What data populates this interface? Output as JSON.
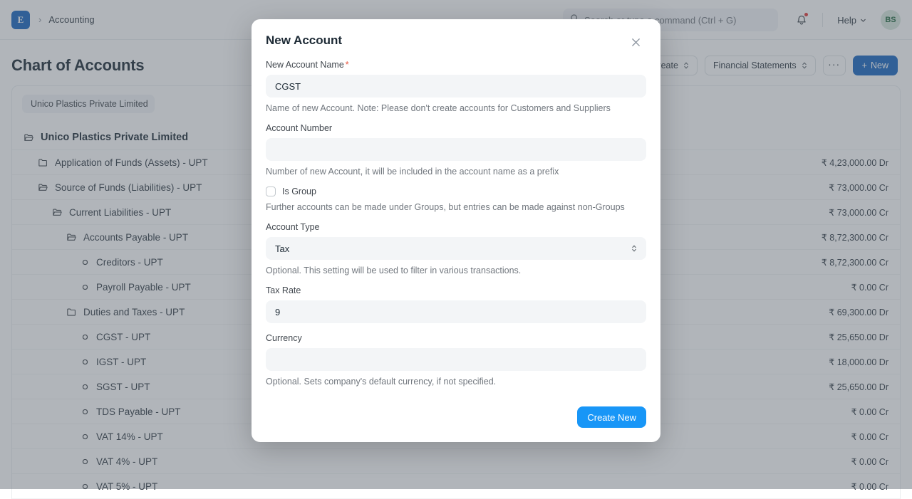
{
  "navbar": {
    "logo_glyph": "E",
    "breadcrumb_separator": "›",
    "breadcrumb_item": "Accounting",
    "search_placeholder": "Search or type a command (Ctrl + G)",
    "search_value": "",
    "help_label": "Help",
    "avatar_initials": "BS"
  },
  "page": {
    "title": "Chart of Accounts",
    "filter_chip": "Unico Plastics Private Limited",
    "actions": {
      "create_label": "Create",
      "financial_statements_label": "Financial Statements",
      "more_label": "···",
      "new_label": "New",
      "new_prefix": "+"
    }
  },
  "tree": {
    "rows": [
      {
        "label": "Unico Plastics Private Limited",
        "icon": "folder-open-icon",
        "depth": 0,
        "amount": "",
        "root": true
      },
      {
        "label": "Application of Funds (Assets) - UPT",
        "icon": "folder-icon",
        "depth": 1,
        "amount": "₹ 4,23,000.00 Dr",
        "root": false
      },
      {
        "label": "Source of Funds (Liabilities) - UPT",
        "icon": "folder-open-icon",
        "depth": 1,
        "amount": "₹ 73,000.00 Cr",
        "root": false
      },
      {
        "label": "Current Liabilities - UPT",
        "icon": "folder-open-icon",
        "depth": 2,
        "amount": "₹ 73,000.00 Cr",
        "root": false
      },
      {
        "label": "Accounts Payable - UPT",
        "icon": "folder-open-icon",
        "depth": 3,
        "amount": "₹ 8,72,300.00 Cr",
        "root": false
      },
      {
        "label": "Creditors - UPT",
        "icon": "leaf-circle-icon",
        "depth": 4,
        "amount": "₹ 8,72,300.00 Cr",
        "root": false
      },
      {
        "label": "Payroll Payable - UPT",
        "icon": "leaf-circle-icon",
        "depth": 4,
        "amount": "₹ 0.00 Cr",
        "root": false
      },
      {
        "label": "Duties and Taxes - UPT",
        "icon": "folder-icon",
        "depth": 3,
        "amount": "₹ 69,300.00 Dr",
        "root": false
      },
      {
        "label": "CGST - UPT",
        "icon": "leaf-circle-icon",
        "depth": 4,
        "amount": "₹ 25,650.00 Dr",
        "root": false
      },
      {
        "label": "IGST - UPT",
        "icon": "leaf-circle-icon",
        "depth": 4,
        "amount": "₹ 18,000.00 Dr",
        "root": false
      },
      {
        "label": "SGST - UPT",
        "icon": "leaf-circle-icon",
        "depth": 4,
        "amount": "₹ 25,650.00 Dr",
        "root": false
      },
      {
        "label": "TDS Payable - UPT",
        "icon": "leaf-circle-icon",
        "depth": 4,
        "amount": "₹ 0.00 Cr",
        "root": false
      },
      {
        "label": "VAT 14% - UPT",
        "icon": "leaf-circle-icon",
        "depth": 4,
        "amount": "₹ 0.00 Cr",
        "root": false
      },
      {
        "label": "VAT 4% - UPT",
        "icon": "leaf-circle-icon",
        "depth": 4,
        "amount": "₹ 0.00 Cr",
        "root": false
      },
      {
        "label": "VAT 5% - UPT",
        "icon": "leaf-circle-icon",
        "depth": 4,
        "amount": "₹ 0.00 Cr",
        "root": false
      }
    ]
  },
  "modal": {
    "title": "New Account",
    "close_glyph": "×",
    "fields": {
      "account_name": {
        "label": "New Account Name",
        "required_marker": "*",
        "value": "CGST",
        "placeholder": "",
        "help": "Name of new Account. Note: Please don't create accounts for Customers and Suppliers"
      },
      "account_number": {
        "label": "Account Number",
        "value": "",
        "placeholder": "",
        "help": "Number of new Account, it will be included in the account name as a prefix"
      },
      "is_group": {
        "label": "Is Group",
        "checked": false,
        "help": "Further accounts can be made under Groups, but entries can be made against non-Groups"
      },
      "account_type": {
        "label": "Account Type",
        "value": "Tax",
        "help": "Optional. This setting will be used to filter in various transactions."
      },
      "tax_rate": {
        "label": "Tax Rate",
        "value": "9",
        "placeholder": "",
        "help": ""
      },
      "currency": {
        "label": "Currency",
        "value": "",
        "placeholder": "",
        "help": "Optional. Sets company's default currency, if not specified."
      }
    },
    "submit_label": "Create New"
  },
  "colors": {
    "brand_blue": "#1665c0",
    "accent_blue": "#1896f7",
    "required_red": "#e8563f",
    "avatar_green": "#22683f",
    "notification_red": "#e03636"
  }
}
